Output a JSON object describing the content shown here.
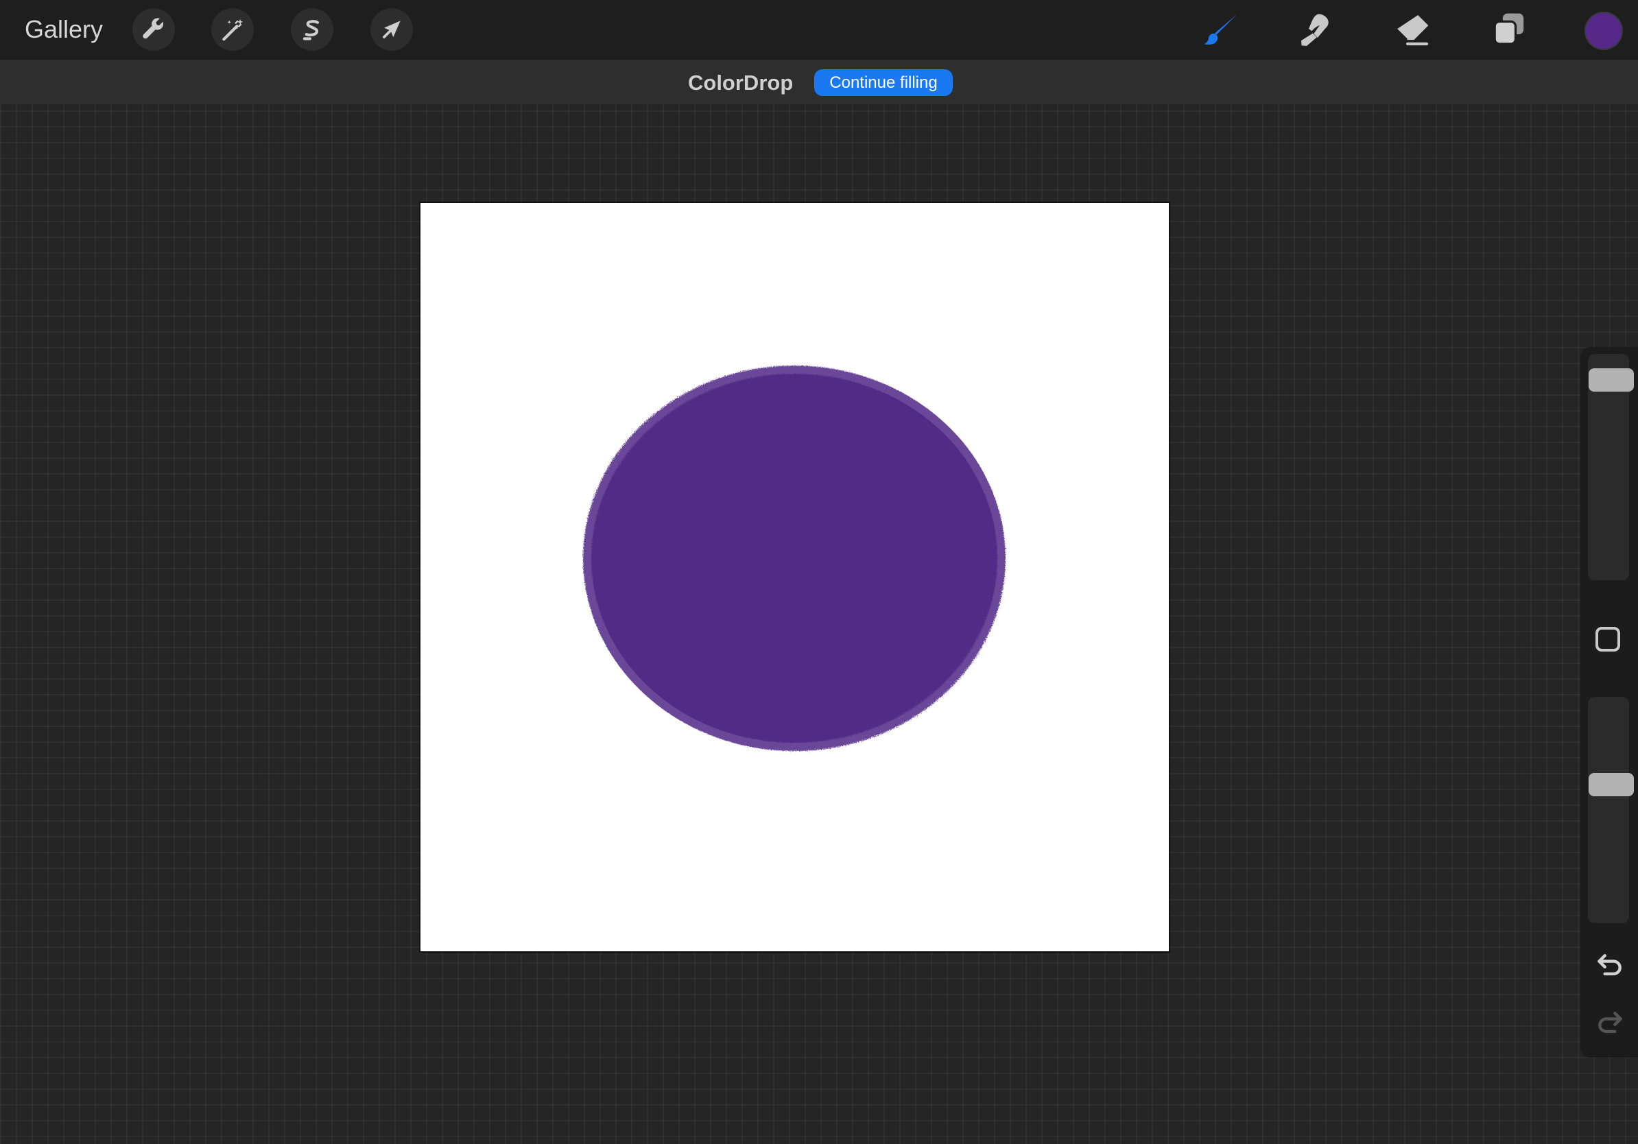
{
  "toolbar": {
    "gallery_label": "Gallery",
    "left_tools": [
      {
        "name": "actions",
        "icon": "wrench-icon"
      },
      {
        "name": "adjustments",
        "icon": "magic-wand-icon"
      },
      {
        "name": "selection",
        "icon": "selection-s-icon"
      },
      {
        "name": "transform",
        "icon": "arrow-cursor-icon"
      }
    ],
    "right_tools": [
      {
        "name": "brush",
        "icon": "paintbrush-icon",
        "active": true
      },
      {
        "name": "smudge",
        "icon": "smudge-finger-icon",
        "active": false
      },
      {
        "name": "eraser",
        "icon": "eraser-icon",
        "active": false
      },
      {
        "name": "layers",
        "icon": "layers-icon",
        "active": false
      }
    ],
    "current_color": "#56288a"
  },
  "mode_bar": {
    "mode_label": "ColorDrop",
    "action_label": "Continue filling"
  },
  "canvas": {
    "background_color": "#ffffff",
    "fill_color": "#532a86",
    "outline_color": "#6a4799",
    "shape": "filled-ellipse"
  },
  "sidebar": {
    "brush_size_level": 0.06,
    "opacity_level": 0.37,
    "modify_icon": "square-icon",
    "undo_icon": "undo-icon",
    "redo_icon": "redo-icon",
    "redo_enabled": false
  },
  "colors": {
    "accent": "#1a78f0",
    "toolbar_bg": "#1e1e1e",
    "workspace_bg": "#252525"
  }
}
